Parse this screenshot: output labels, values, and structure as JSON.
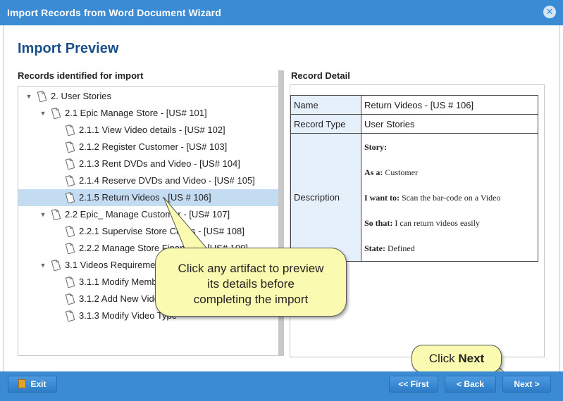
{
  "window": {
    "title": "Import Records from Word Document Wizard",
    "close_icon": "close-icon"
  },
  "page": {
    "title": "Import Preview"
  },
  "left_panel": {
    "label": "Records identified for import",
    "tree": [
      {
        "label": "2. User Stories",
        "expanded": true
      },
      {
        "label": "2.1 Epic Manage Store - [US# 101]",
        "expanded": true
      },
      {
        "label": "2.1.1 View Video details - [US# 102]"
      },
      {
        "label": "2.1.2 Register Customer - [US# 103]"
      },
      {
        "label": "2.1.3 Rent DVDs and Video - [US# 104]"
      },
      {
        "label": "2.1.4 Reserve DVDs and Video - [US# 105]"
      },
      {
        "label": "2.1.5 Return Videos - [US # 106]",
        "selected": true
      },
      {
        "label": "2.2 Epic_ Manage Customer - [US# 107]",
        "expanded": true
      },
      {
        "label": "2.2.1 Supervise Store Clerks - [US# 108]"
      },
      {
        "label": "2.2.2 Manage Store Finances - [US# 109]"
      },
      {
        "label": "3.1 Videos Requirements",
        "expanded": true
      },
      {
        "label": "3.1.1 Modify Member"
      },
      {
        "label": "3.1.2 Add New Video"
      },
      {
        "label": "3.1.3 Modify Video Type"
      }
    ]
  },
  "right_panel": {
    "label": "Record Detail",
    "rows": {
      "name_key": "Name",
      "name_value": "Return Videos - [US # 106]",
      "type_key": "Record Type",
      "type_value": "User Stories",
      "desc_key": "Description"
    },
    "description": {
      "story_label": "Story:",
      "as_a_label": "As a:",
      "as_a_value": "Customer",
      "want_label": "I want to:",
      "want_value": "Scan the bar-code on a Video",
      "so_that_label": "So that:",
      "so_that_value": "I can return videos easily",
      "state_label": "State:",
      "state_value": "Defined"
    }
  },
  "footer": {
    "exit": "Exit",
    "first": "<< First",
    "back": "< Back",
    "next": "Next >"
  },
  "callouts": {
    "preview_line1": "Click any artifact to preview",
    "preview_line2": "its details before",
    "preview_line3": "completing the import",
    "next_prefix": "Click",
    "next_bold": "Next"
  },
  "colors": {
    "header": "#3a8ad4",
    "title_text": "#1a4f8b",
    "selected_row": "#c4dcf2",
    "callout": "#fafab0"
  }
}
